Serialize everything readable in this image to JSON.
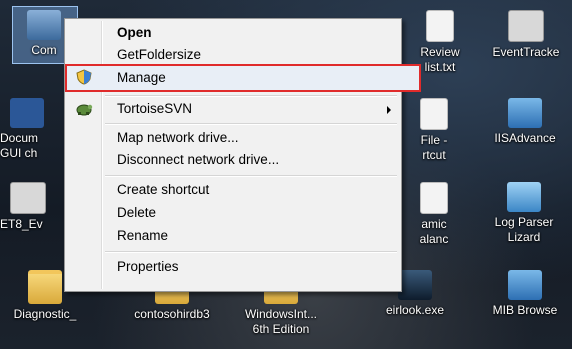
{
  "desktop": {
    "icons": [
      {
        "label": "Com",
        "label2": ""
      },
      {
        "label": "Review",
        "label2": "list.txt"
      },
      {
        "label": "EventTracke",
        "label2": ""
      },
      {
        "label": "Docum",
        "label2": "GUI ch"
      },
      {
        "label": "File -",
        "label2": "rtcut"
      },
      {
        "label": "IISAdvance",
        "label2": ""
      },
      {
        "label": "ET8_Ev",
        "label2": ""
      },
      {
        "label": "amic",
        "label2": "alanc"
      },
      {
        "label": "Log Parser",
        "label2": "Lizard"
      },
      {
        "label": "Diagnostic_",
        "label2": ""
      },
      {
        "label": "contosohirdb3",
        "label2": ""
      },
      {
        "label": "WindowsInt...",
        "label2": "6th Edition"
      },
      {
        "label": "eirlook.exe",
        "label2": ""
      },
      {
        "label": "MIB Browse",
        "label2": ""
      }
    ]
  },
  "context_menu": {
    "items": [
      {
        "label": "Open"
      },
      {
        "label": "GetFoldersize"
      },
      {
        "label": "Manage"
      },
      {
        "label": "TortoiseSVN"
      },
      {
        "label": "Map network drive..."
      },
      {
        "label": "Disconnect network drive..."
      },
      {
        "label": "Create shortcut"
      },
      {
        "label": "Delete"
      },
      {
        "label": "Rename"
      },
      {
        "label": "Properties"
      }
    ],
    "highlight_color": "#e02b2b"
  }
}
